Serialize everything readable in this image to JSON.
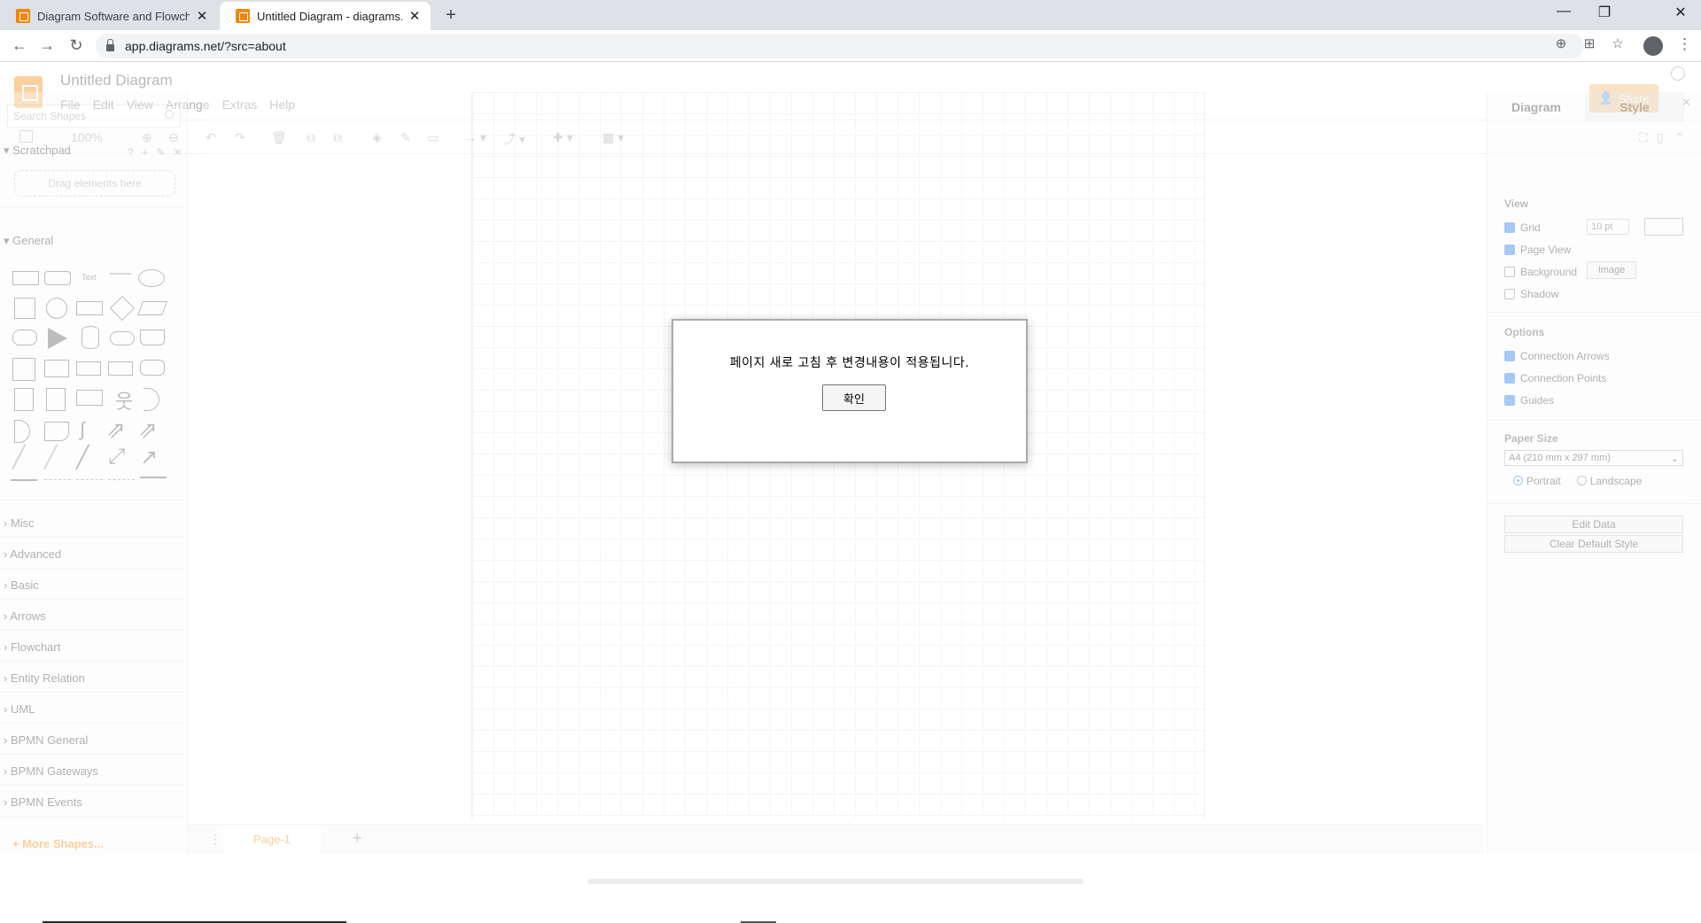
{
  "browser": {
    "tabs": [
      {
        "title": "Diagram Software and Flowchar",
        "close": "✕"
      },
      {
        "title": "Untitled Diagram - diagrams.ne",
        "close": "✕"
      }
    ],
    "new_tab": "+",
    "window_controls": {
      "minimize": "—",
      "restore": "❐",
      "close": "✕"
    },
    "nav": {
      "back": "←",
      "forward": "→",
      "reload": "↻"
    },
    "url": "app.diagrams.net/?src=about",
    "kebab": "⋮"
  },
  "app": {
    "title": "Untitled Diagram",
    "menu": [
      "File",
      "Edit",
      "View",
      "Arrange",
      "Extras",
      "Help"
    ],
    "share_label": "Share",
    "toolbar": {
      "zoom": "100%"
    },
    "sidebar": {
      "search_placeholder": "Search Shapes",
      "scratchpad": "Scratchpad",
      "scratchpad_tools": "? + ✎ ✕",
      "drop_hint": "Drag elements here",
      "general": "General",
      "text_shape_label": "Text",
      "libraries": [
        "Misc",
        "Advanced",
        "Basic",
        "Arrows",
        "Flowchart",
        "Entity Relation",
        "UML",
        "BPMN General",
        "BPMN Gateways",
        "BPMN Events"
      ],
      "more_shapes": "+ More Shapes..."
    },
    "page_tab": "Page-1",
    "right_panel": {
      "tabs": [
        "Diagram",
        "Style"
      ],
      "close": "✕",
      "view_heading": "View",
      "view_options": [
        {
          "label": "Grid",
          "checked": true
        },
        {
          "label": "Page View",
          "checked": true
        },
        {
          "label": "Background",
          "checked": false
        },
        {
          "label": "Shadow",
          "checked": false
        }
      ],
      "grid_size": "10 pt",
      "image_button": "Image",
      "options_heading": "Options",
      "options": [
        {
          "label": "Connection Arrows",
          "checked": true
        },
        {
          "label": "Connection Points",
          "checked": true
        },
        {
          "label": "Guides",
          "checked": true
        }
      ],
      "paper_heading": "Paper Size",
      "paper_value": "A4 (210 mm x 297 mm)",
      "orientation": {
        "portrait": "Portrait",
        "landscape": "Landscape",
        "selected": "Portrait"
      },
      "edit_data": "Edit Data",
      "clear_style": "Clear Default Style"
    }
  },
  "dialog": {
    "message": "페이지 새로 고침 후 변경내용이 적용됩니다.",
    "ok_label": "확인"
  },
  "colors": {
    "accent": "#f08705",
    "share": "#f4b46a",
    "checkbox": "#1a73e8"
  }
}
